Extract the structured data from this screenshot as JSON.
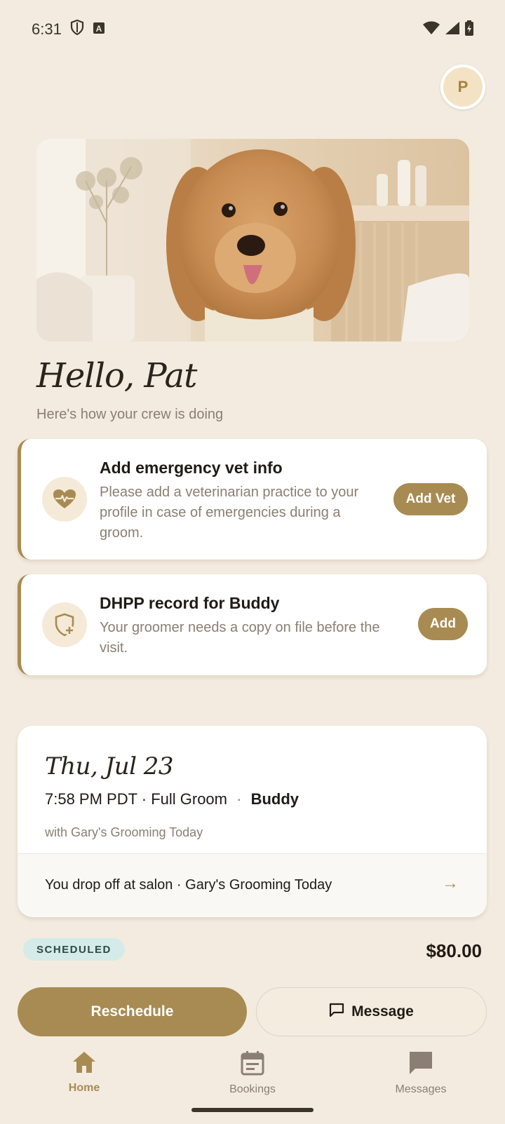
{
  "status_bar": {
    "time": "6:31",
    "icons": [
      "shield-icon",
      "text-a-icon",
      "wifi-icon",
      "signal-icon",
      "battery-charging-icon"
    ]
  },
  "avatar": {
    "initial": "P"
  },
  "hero": {
    "image": "golden-doodle-dog-photo"
  },
  "greeting": {
    "title": "Hello, Pat",
    "subtitle": "Here's how your crew is doing"
  },
  "alerts": [
    {
      "icon": "heart-pulse-icon",
      "title": "Add emergency vet info",
      "lines": [
        "Please add a veterinarian practice to your",
        "profile in case of emergencies during a",
        "groom."
      ],
      "button": "Add Vet"
    },
    {
      "icon": "shield-plus-icon",
      "title": "DHPP record for Buddy",
      "lines": [
        "Your groomer needs a copy on file before the",
        "visit."
      ],
      "button": "Add"
    }
  ],
  "booking": {
    "date": "Thu, Jul 23",
    "time_service": "7:58 PM PDT · Full Groom",
    "separator": "·",
    "pet": "Buddy",
    "with": "with Gary's Grooming Today",
    "dropoff": "You drop off at salon · Gary's Grooming Today",
    "arrow": "→"
  },
  "status": {
    "badge": "SCHEDULED",
    "price": "$80.00"
  },
  "actions": {
    "reschedule": "Reschedule",
    "message": "Message"
  },
  "nav": [
    {
      "label": "Home",
      "icon": "home-icon",
      "active": true
    },
    {
      "label": "Bookings",
      "icon": "calendar-icon",
      "active": false
    },
    {
      "label": "Messages",
      "icon": "chat-icon",
      "active": false
    }
  ],
  "colors": {
    "background": "#f3ebdf",
    "accent": "#a88b52",
    "badge_bg": "#d4ebe9"
  }
}
